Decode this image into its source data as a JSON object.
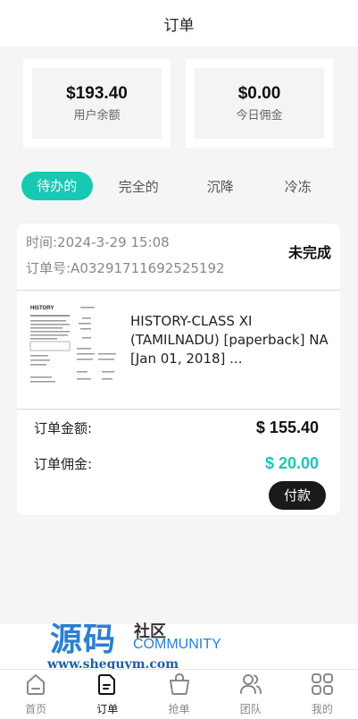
{
  "header": {
    "title": "订单"
  },
  "stats": [
    {
      "value": "$193.40",
      "label": "用户余额"
    },
    {
      "value": "$0.00",
      "label": "今日佣金"
    }
  ],
  "tabs": [
    {
      "label": "待办的",
      "active": true
    },
    {
      "label": "完全的",
      "active": false
    },
    {
      "label": "沉降",
      "active": false
    },
    {
      "label": "冷冻",
      "active": false
    }
  ],
  "order": {
    "time": "时间:2024-3-29 15:08",
    "number": "订单号:A03291711692525192",
    "status": "未完成",
    "product_name": "HISTORY-CLASS XI (TAMILNADU) [paperback] NA [Jan 01, 2018] ...",
    "thumbnail_title": "HISTORY",
    "amount_label": "订单金额:",
    "amount_value": "$ 155.40",
    "commission_label": "订单佣金:",
    "commission_value": "$ 20.00",
    "pay_button": "付款"
  },
  "watermark": {
    "main": "源码",
    "sub1": "社区",
    "sub2": "COMMUNITY",
    "url": "www.shequym.com"
  },
  "tabbar": [
    {
      "label": "首页",
      "icon": "home-icon",
      "active": false
    },
    {
      "label": "订单",
      "icon": "order-icon",
      "active": true
    },
    {
      "label": "抢单",
      "icon": "grab-order-icon",
      "active": false
    },
    {
      "label": "团队",
      "icon": "team-icon",
      "active": false
    },
    {
      "label": "我的",
      "icon": "grid-icon",
      "active": false
    }
  ],
  "colors": {
    "accent": "#17c9b3",
    "dark_button": "#1a1a1a",
    "watermark_blue": "#2a7fd1"
  }
}
